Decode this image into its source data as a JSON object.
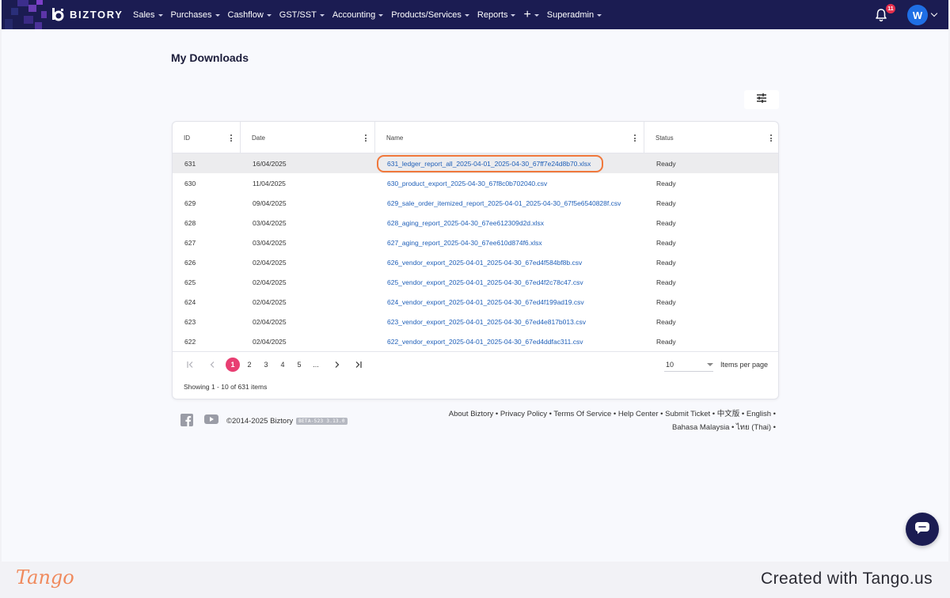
{
  "brand": {
    "name": "BIZTORY"
  },
  "nav": {
    "items": [
      {
        "label": "Sales"
      },
      {
        "label": "Purchases"
      },
      {
        "label": "Cashflow"
      },
      {
        "label": "GST/SST"
      },
      {
        "label": "Accounting"
      },
      {
        "label": "Products/Services"
      },
      {
        "label": "Reports"
      },
      {
        "label": "+"
      },
      {
        "label": "Superadmin"
      }
    ],
    "notification_count": "11",
    "avatar_initial": "W"
  },
  "page": {
    "title": "My Downloads"
  },
  "table": {
    "columns": [
      "ID",
      "Date",
      "Name",
      "Status"
    ],
    "rows": [
      {
        "id": "631",
        "date": "16/04/2025",
        "name": "631_ledger_report_all_2025-04-01_2025-04-30_67ff7e24d8b70.xlsx",
        "status": "Ready"
      },
      {
        "id": "630",
        "date": "11/04/2025",
        "name": "630_product_export_2025-04-30_67f8c0b702040.csv",
        "status": "Ready"
      },
      {
        "id": "629",
        "date": "09/04/2025",
        "name": "629_sale_order_itemized_report_2025-04-01_2025-04-30_67f5e6540828f.csv",
        "status": "Ready"
      },
      {
        "id": "628",
        "date": "03/04/2025",
        "name": "628_aging_report_2025-04-30_67ee612309d2d.xlsx",
        "status": "Ready"
      },
      {
        "id": "627",
        "date": "03/04/2025",
        "name": "627_aging_report_2025-04-30_67ee610d874f6.xlsx",
        "status": "Ready"
      },
      {
        "id": "626",
        "date": "02/04/2025",
        "name": "626_vendor_export_2025-04-01_2025-04-30_67ed4f584bf8b.csv",
        "status": "Ready"
      },
      {
        "id": "625",
        "date": "02/04/2025",
        "name": "625_vendor_export_2025-04-01_2025-04-30_67ed4f2c78c47.csv",
        "status": "Ready"
      },
      {
        "id": "624",
        "date": "02/04/2025",
        "name": "624_vendor_export_2025-04-01_2025-04-30_67ed4f199ad19.csv",
        "status": "Ready"
      },
      {
        "id": "623",
        "date": "02/04/2025",
        "name": "623_vendor_export_2025-04-01_2025-04-30_67ed4e817b013.csv",
        "status": "Ready"
      },
      {
        "id": "622",
        "date": "02/04/2025",
        "name": "622_vendor_export_2025-04-01_2025-04-30_67ed4ddfac311.csv",
        "status": "Ready"
      }
    ]
  },
  "pagination": {
    "pages": [
      "1",
      "2",
      "3",
      "4",
      "5",
      "..."
    ],
    "current": "1",
    "page_size": "10",
    "items_per_page_label": "Items per page",
    "summary": "Showing 1 - 10 of 631 items"
  },
  "footer": {
    "copyright": "©2014-2025 Biztory",
    "version": "BETA-523 3.13.0",
    "links_line1": "About Biztory • Privacy Policy • Terms Of Service • Help Center • Submit Ticket • 中文版 • English •",
    "links_line2": "Bahasa Malaysia • ไทย (Thai) •"
  },
  "tango": {
    "logo": "Tango",
    "credit": "Created with Tango.us"
  },
  "colors": {
    "nav_bg": "#1b1c52",
    "accent_pink": "#e83e72",
    "link": "#1f5fb8",
    "highlight_ring": "#f0783c"
  }
}
